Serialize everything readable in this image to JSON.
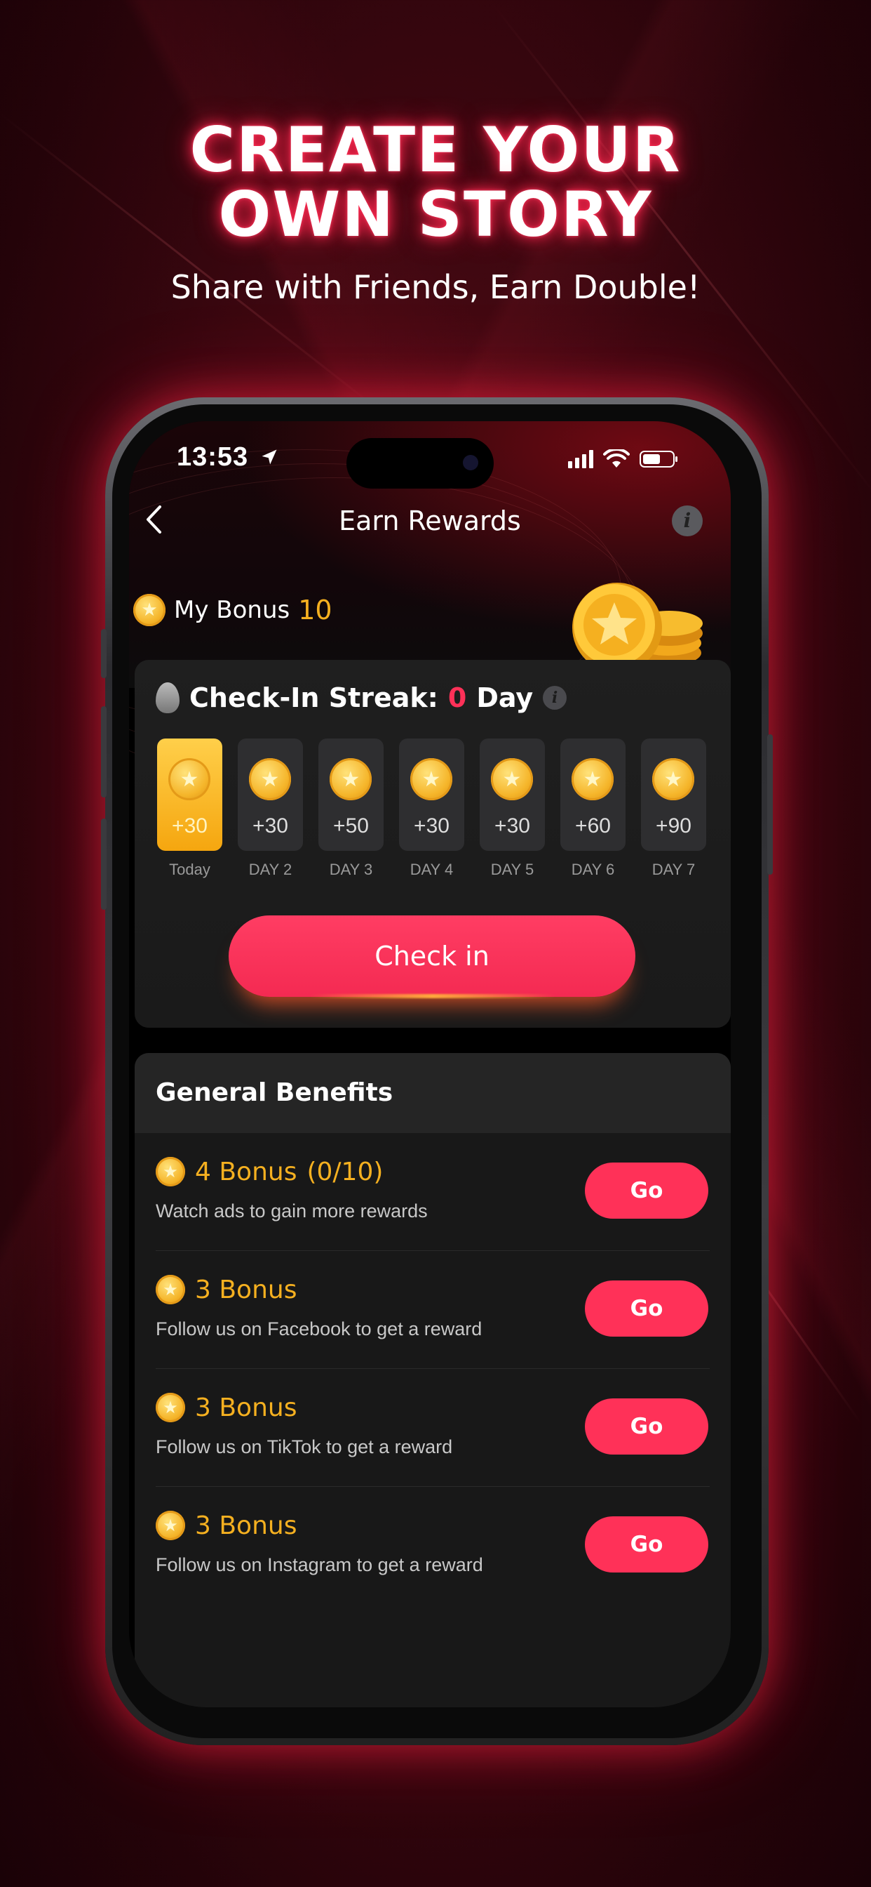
{
  "hero": {
    "title_line1": "CREATE YOUR",
    "title_line2": "OWN STORY",
    "subtitle": "Share with Friends, Earn Double!"
  },
  "status_bar": {
    "time": "13:53"
  },
  "nav": {
    "back_icon": "chevron-left-icon",
    "title": "Earn Rewards",
    "info_icon": "info-icon"
  },
  "my_bonus": {
    "label": "My Bonus",
    "value": "10"
  },
  "streak": {
    "label": "Check-In Streak:",
    "count": "0",
    "unit": "Day",
    "days": [
      {
        "amount": "+30",
        "label": "Today",
        "active": true
      },
      {
        "amount": "+30",
        "label": "DAY 2"
      },
      {
        "amount": "+50",
        "label": "DAY 3"
      },
      {
        "amount": "+30",
        "label": "DAY 4"
      },
      {
        "amount": "+30",
        "label": "DAY 5"
      },
      {
        "amount": "+60",
        "label": "DAY 6"
      },
      {
        "amount": "+90",
        "label": "DAY 7"
      }
    ],
    "checkin_label": "Check in"
  },
  "benefits": {
    "title": "General Benefits",
    "items": [
      {
        "title": "4 Bonus",
        "progress": "(0/10)",
        "desc": "Watch ads to gain more rewards",
        "button": "Go"
      },
      {
        "title": "3 Bonus",
        "progress": "",
        "desc": "Follow us on Facebook to get a reward",
        "button": "Go"
      },
      {
        "title": "3 Bonus",
        "progress": "",
        "desc": "Follow us on TikTok to get a reward",
        "button": "Go"
      },
      {
        "title": "3 Bonus",
        "progress": "",
        "desc": "Follow us on Instagram to get a reward",
        "button": "Go"
      }
    ]
  },
  "colors": {
    "accent": "#ff3158",
    "gold": "#f5b020",
    "background": "#3d0710"
  }
}
